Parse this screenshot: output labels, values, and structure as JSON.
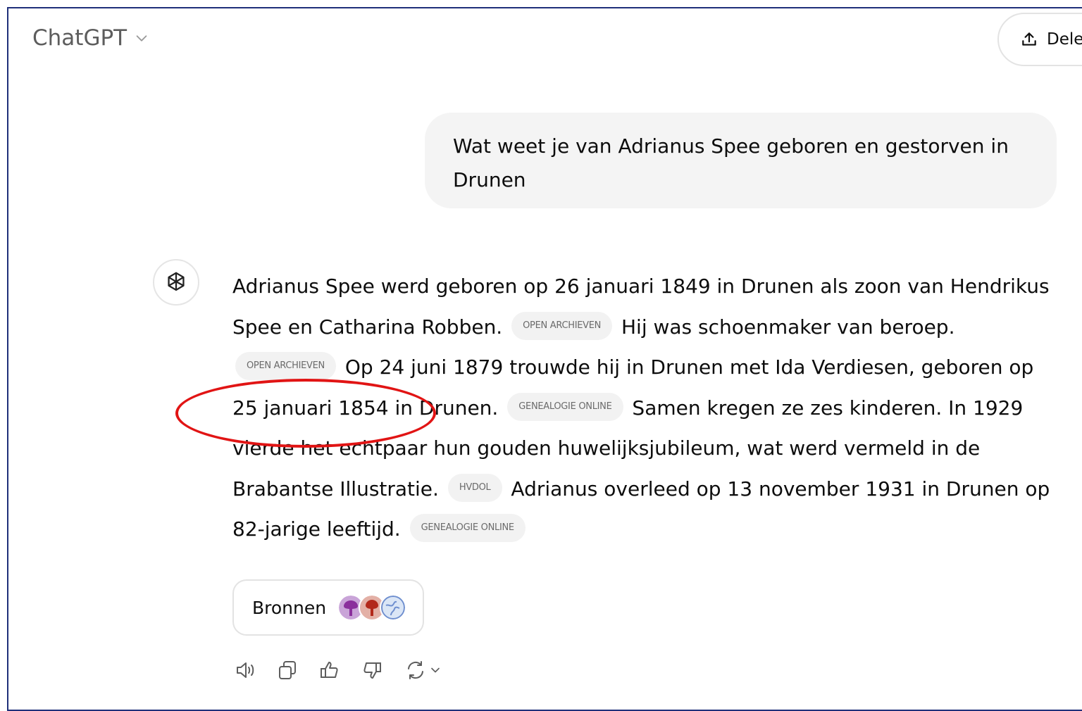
{
  "header": {
    "app_title": "ChatGPT",
    "share_label": "Dele"
  },
  "conversation": {
    "user_message": "Wat weet je van Adrianus Spee geboren en gestorven in Drunen",
    "assistant": {
      "segments": {
        "s1": "Adrianus Spee werd geboren op 26 januari 1849 in Drunen als zoon van Hendrikus Spee en Catharina Robben.",
        "c1": "OPEN ARCHIEVEN",
        "s2": "Hij was schoenmaker van beroep.",
        "c2": "OPEN ARCHIEVEN",
        "s3": "Op 24 juni 1879 trouwde hij in Drunen met Ida Verdiesen, geboren op 25 januari 1854 in Drunen.",
        "c3": "GENEALOGIE ONLINE",
        "s4": "Samen kregen ze zes kinderen. In 1929 vierde het echtpaar hun gouden huwelijksjubileum, wat werd vermeld in de Brabantse Illustratie.",
        "c4": "HVDOL",
        "s5": "Adrianus overleed op 13 november 1931 in Drunen op 82-jarige leeftijd.",
        "c5": "GENEALOGIE ONLINE"
      }
    }
  },
  "sources": {
    "label": "Bronnen",
    "icons": [
      "purple-tree-icon",
      "red-tree-icon",
      "globe-icon"
    ]
  },
  "actions": [
    "read-aloud-icon",
    "copy-icon",
    "thumbs-up-icon",
    "thumbs-down-icon",
    "regenerate-icon"
  ],
  "colors": {
    "annotation_circle": "#e11414",
    "user_bubble_bg": "#f4f4f4",
    "citation_bg": "#f2f2f2",
    "frame_border": "#1f2f7a"
  }
}
